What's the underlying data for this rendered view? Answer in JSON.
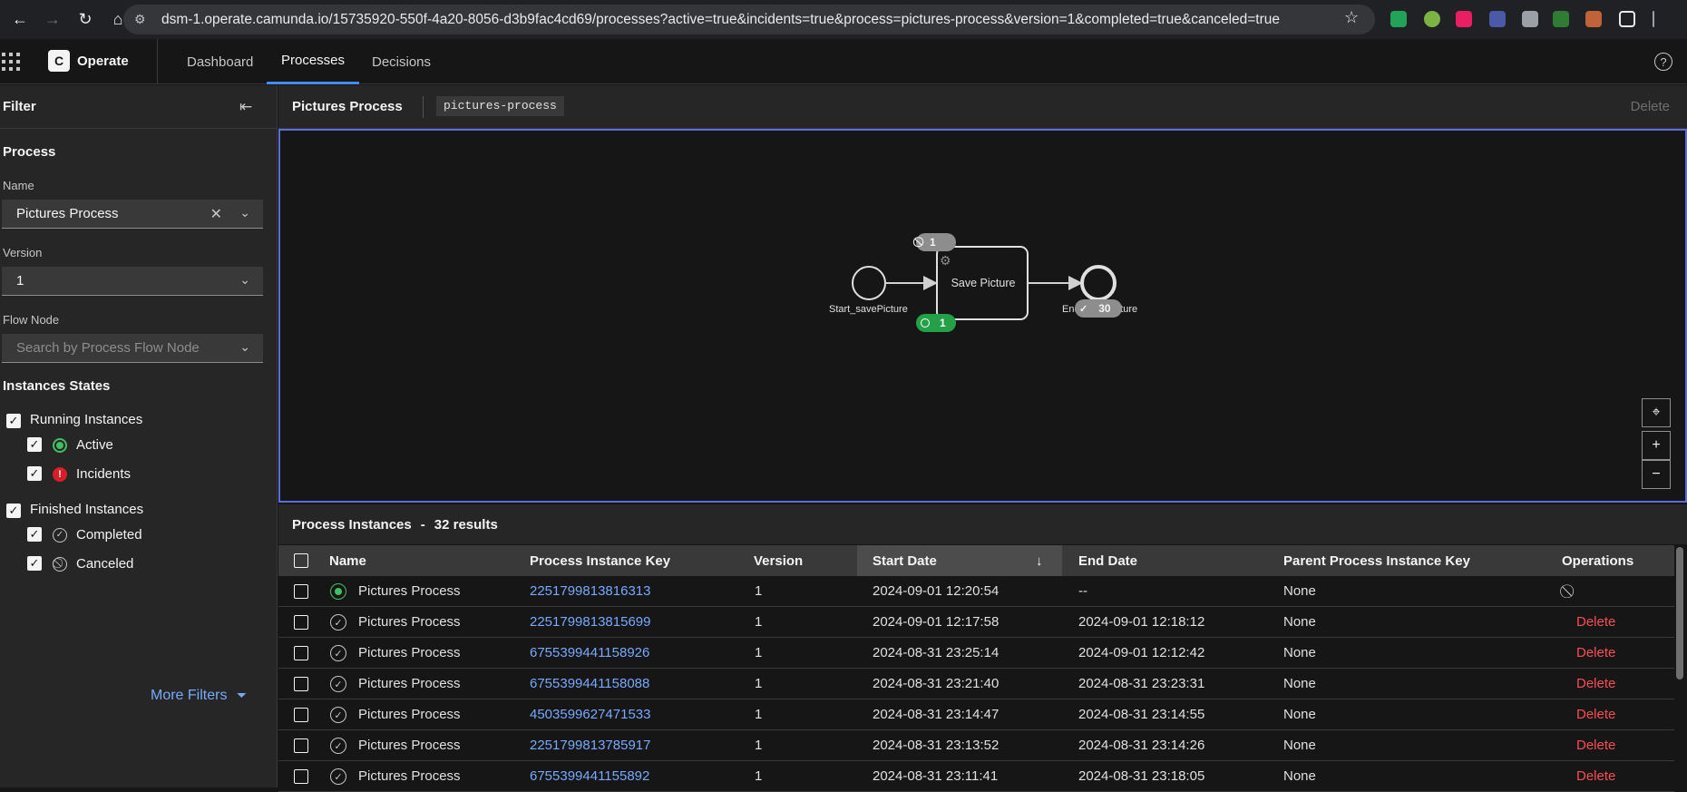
{
  "browser": {
    "url": "dsm-1.operate.camunda.io/15735920-550f-4a20-8056-d3b9fac4cd69/processes?active=true&incidents=true&process=pictures-process&version=1&completed=true&canceled=true"
  },
  "header": {
    "brand": "Operate",
    "logo_letter": "C",
    "tabs": [
      {
        "label": "Dashboard"
      },
      {
        "label": "Processes"
      },
      {
        "label": "Decisions"
      }
    ]
  },
  "sidebar": {
    "title": "Filter",
    "process_section": "Process",
    "name_label": "Name",
    "name_value": "Pictures Process",
    "version_label": "Version",
    "version_value": "1",
    "flow_node_label": "Flow Node",
    "flow_node_placeholder": "Search by Process Flow Node",
    "states_title": "Instances States",
    "running": "Running Instances",
    "active": "Active",
    "incidents": "Incidents",
    "finished": "Finished Instances",
    "completed": "Completed",
    "canceled": "Canceled",
    "more_filters": "More Filters"
  },
  "process_header": {
    "title": "Pictures Process",
    "id": "pictures-process",
    "delete": "Delete"
  },
  "diagram": {
    "start_label": "Start_savePicture",
    "task_label": "Save Picture",
    "end_label": "End_savePicture",
    "canceled_count": "1",
    "active_count": "1",
    "completed_count": "30"
  },
  "instances": {
    "title": "Process Instances",
    "separator": "-",
    "results": "32 results",
    "columns": [
      "Name",
      "Process Instance Key",
      "Version",
      "Start Date",
      "End Date",
      "Parent Process Instance Key",
      "Operations"
    ],
    "rows": [
      {
        "state": "active",
        "name": "Pictures Process",
        "key": "2251799813816313",
        "version": "1",
        "start": "2024-09-01 12:20:54",
        "end": "--",
        "parent": "None",
        "op": ""
      },
      {
        "state": "completed",
        "name": "Pictures Process",
        "key": "2251799813815699",
        "version": "1",
        "start": "2024-09-01 12:17:58",
        "end": "2024-09-01 12:18:12",
        "parent": "None",
        "op": "Delete"
      },
      {
        "state": "completed",
        "name": "Pictures Process",
        "key": "6755399441158926",
        "version": "1",
        "start": "2024-08-31 23:25:14",
        "end": "2024-09-01 12:12:42",
        "parent": "None",
        "op": "Delete"
      },
      {
        "state": "completed",
        "name": "Pictures Process",
        "key": "6755399441158088",
        "version": "1",
        "start": "2024-08-31 23:21:40",
        "end": "2024-08-31 23:23:31",
        "parent": "None",
        "op": "Delete"
      },
      {
        "state": "completed",
        "name": "Pictures Process",
        "key": "4503599627471533",
        "version": "1",
        "start": "2024-08-31 23:14:47",
        "end": "2024-08-31 23:14:55",
        "parent": "None",
        "op": "Delete"
      },
      {
        "state": "completed",
        "name": "Pictures Process",
        "key": "2251799813785917",
        "version": "1",
        "start": "2024-08-31 23:13:52",
        "end": "2024-08-31 23:14:26",
        "parent": "None",
        "op": "Delete"
      },
      {
        "state": "completed",
        "name": "Pictures Process",
        "key": "6755399441155892",
        "version": "1",
        "start": "2024-08-31 23:11:41",
        "end": "2024-08-31 23:18:05",
        "parent": "None",
        "op": "Delete"
      }
    ]
  },
  "colors": {
    "accent": "#4589ff",
    "active": "#42be65",
    "danger": "#fa4d56",
    "link": "#78a9ff"
  }
}
